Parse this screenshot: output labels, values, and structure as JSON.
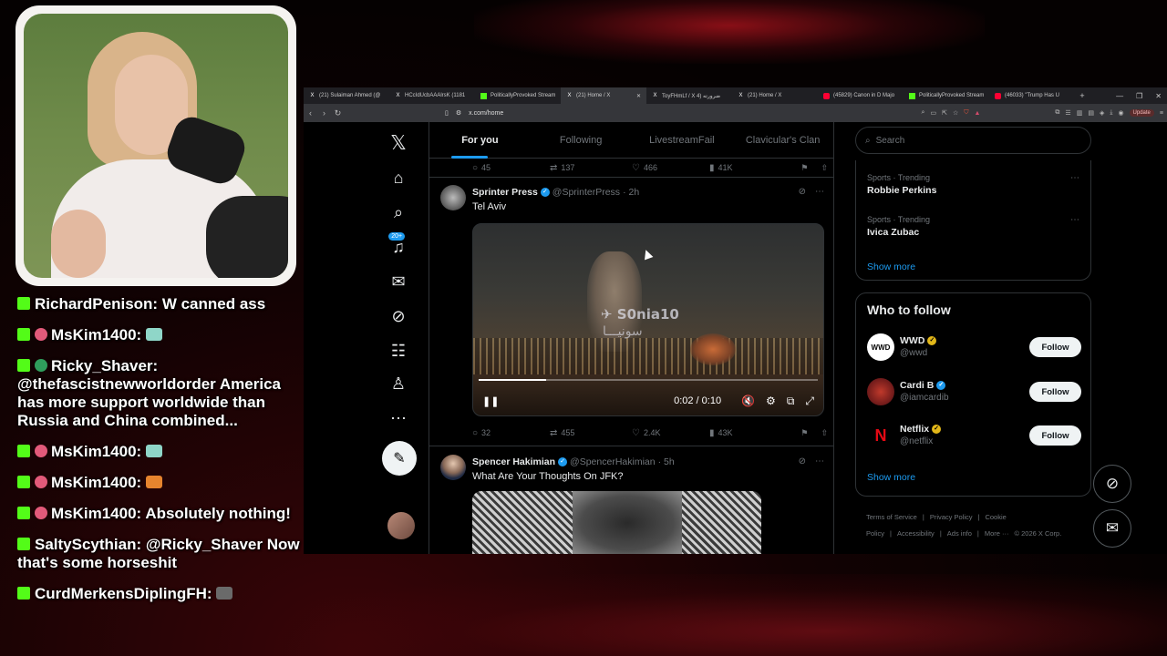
{
  "colors": {
    "accent": "#1d9bf0",
    "kick_green": "#53fc18",
    "background": "#000000"
  },
  "chat": [
    {
      "user": "RichardPenison:",
      "message": "W canned ass",
      "badge": "",
      "emote": ""
    },
    {
      "user": "MsKim1400:",
      "message": "",
      "badge": "pink",
      "emote": "teal"
    },
    {
      "user": "Ricky_Shaver:",
      "message": "@thefascistnewworldorder America has more support worldwide than Russia and China combined...",
      "badge": "green",
      "emote": ""
    },
    {
      "user": "MsKim1400:",
      "message": "",
      "badge": "pink",
      "emote": "teal"
    },
    {
      "user": "MsKim1400:",
      "message": "",
      "badge": "pink",
      "emote": "orange"
    },
    {
      "user": "MsKim1400:",
      "message": "Absolutely nothing!",
      "badge": "pink",
      "emote": ""
    },
    {
      "user": "SaltyScythian:",
      "message": "@Ricky_Shaver Now that's some horseshit",
      "badge": "",
      "emote": ""
    },
    {
      "user": "CurdMerkensDiplingFH:",
      "message": "",
      "badge": "",
      "emote": "gray"
    }
  ],
  "browser": {
    "tabs": [
      {
        "label": "(21) Sulaiman Ahmed (@",
        "icon": "x-icon"
      },
      {
        "label": "HCcIdUcbAAAlrsK (1181",
        "icon": "x-icon"
      },
      {
        "label": "PoliticallyProvoked Stream",
        "icon": "kick-icon"
      },
      {
        "label": "(21) Home / X",
        "icon": "x-icon"
      },
      {
        "label": "ToyFHmLf / X ضرورته (4",
        "icon": "x-icon"
      },
      {
        "label": "(21) Home / X",
        "icon": "x-icon"
      },
      {
        "label": "(45829) Canon in D Majo",
        "icon": "youtube-icon"
      },
      {
        "label": "PoliticallyProvoked Stream",
        "icon": "kick-icon"
      },
      {
        "label": "(46033) \"Trump Has U",
        "icon": "youtube-icon"
      }
    ],
    "url": "x.com/home",
    "update_label": "Update"
  },
  "x": {
    "notif_count": "20+",
    "tabs": [
      "For you",
      "Following",
      "LivestreamFail",
      "Clavicular's Clan"
    ],
    "top_actions": {
      "replies": "45",
      "reposts": "137",
      "likes": "466",
      "views": "41K"
    },
    "tweet1": {
      "name": "Sprinter Press",
      "handle": "@SprinterPress",
      "time": "· 2h",
      "text": "Tel Aviv",
      "watermark": "S0nia10",
      "watermark_sub": "سونيـــا",
      "video_time": "0:02 / 0:10",
      "progress": 0.2,
      "replies": "32",
      "reposts": "455",
      "likes": "2.4K",
      "views": "43K"
    },
    "tweet2": {
      "name": "Spencer Hakimian",
      "handle": "@SpencerHakimian",
      "time": "· 5h",
      "text": "What Are Your Thoughts On JFK?"
    },
    "search_placeholder": "Search",
    "trends": [
      {
        "meta": "Sports · Trending",
        "title": "Robbie Perkins"
      },
      {
        "meta": "Sports · Trending",
        "title": "Ivica Zubac"
      }
    ],
    "show_more": "Show more",
    "who_to_follow": "Who to follow",
    "follows": [
      {
        "name": "WWD",
        "handle": "@wwd",
        "check": "gold",
        "avatar_text": "WWD"
      },
      {
        "name": "Cardi B",
        "handle": "@iamcardib",
        "check": "blue",
        "avatar_text": ""
      },
      {
        "name": "Netflix",
        "handle": "@netflix",
        "check": "gold",
        "avatar_text": "N"
      }
    ],
    "follow_label": "Follow",
    "footer": [
      "Terms of Service",
      "|",
      "Privacy Policy",
      "|",
      "Cookie Policy",
      "|",
      "Accessibility",
      "|",
      "Ads info",
      "|",
      "More ···",
      "© 2026 X Corp."
    ]
  }
}
